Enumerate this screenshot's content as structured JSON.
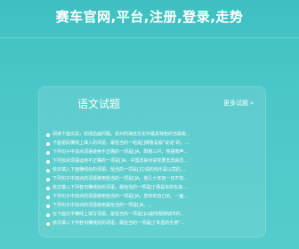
{
  "header": {
    "title": "赛车官网,平台,注册,登录,走势"
  },
  "panel": {
    "title": "语文试题",
    "more_label": "更多试题",
    "more_arrow": "»",
    "items": [
      "阅读下面文段，完成后面问题。泉州的海丝文化中最具特色的当属南...",
      "下面语段横线上填入的词语，最恰当的一组是[]梯鲁是般\"说话\"的。...",
      "下列句子中加点词语使用不正确的一项是[]A。阳春三月，燕语莺声...",
      "下列加点词语运用不正确的一项是[]A。中国改良对进攻要去改良迅...",
      "依次填入下面横线处的词语，恰当的一项是[]它说的快乐是以竟的,...",
      "下列句子中加点的词语使用恰当的一项是[]A。他几十年如一日不如...",
      "依次填入下列各句横线处的词语，最恰当的一项是[]\"我是东的东来...",
      "下列句子中加点的词语使用恰当的一项是[]A。意存有自己的，一面...",
      "下列句子中加点的词语使用最恰当的一项是[]A。...",
      "在下面文中横线上填写词语，最恰当的一项是[]山崩地裂使城市的...",
      "依次填入下列各句横线处的词语，最恰当的一项是[]\"未选的手册\"..."
    ]
  }
}
